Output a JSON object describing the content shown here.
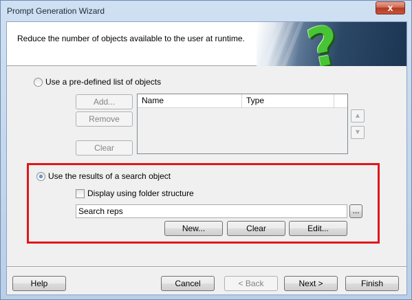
{
  "window": {
    "title": "Prompt Generation Wizard",
    "close_glyph": "x"
  },
  "header": {
    "description": "Reduce the number of objects available to the user at runtime.",
    "graphic_glyph": "?"
  },
  "option_predefined": {
    "label": "Use a pre-defined list of objects",
    "add_label": "Add...",
    "remove_label": "Remove",
    "clear_label": "Clear",
    "columns": [
      "Name",
      "Type"
    ],
    "up_glyph": "▲",
    "down_glyph": "▼"
  },
  "option_search": {
    "label": "Use the results of a search object",
    "folder_checkbox_label": "Display using folder structure",
    "search_value": "Search reps",
    "browse_label": "...",
    "new_label": "New...",
    "clear_label": "Clear",
    "edit_label": "Edit..."
  },
  "footer": {
    "help_label": "Help",
    "cancel_label": "Cancel",
    "back_label": "< Back",
    "next_label": "Next >",
    "finish_label": "Finish"
  }
}
